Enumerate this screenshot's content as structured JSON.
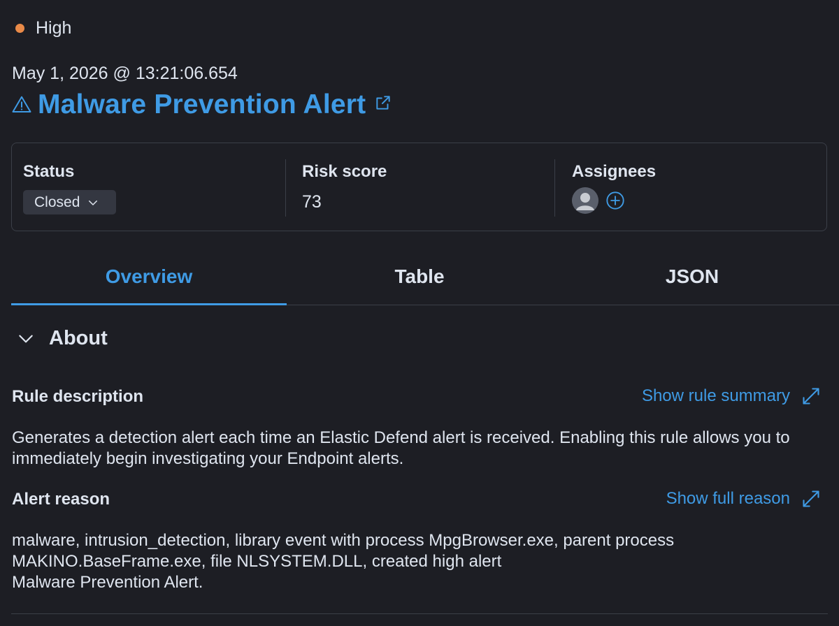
{
  "severity": {
    "label": "High",
    "color": "#e98a48"
  },
  "alert": {
    "timestamp": "May 1, 2026 @ 13:21:06.654",
    "title": "Malware Prevention Alert",
    "title_icon": "warning-icon",
    "link_icon": "external-link-icon"
  },
  "summary": {
    "status": {
      "label": "Status",
      "value": "Closed",
      "icon": "chevron-down-icon"
    },
    "risk": {
      "label": "Risk score",
      "value": "73"
    },
    "assignees": {
      "label": "Assignees",
      "avatar_icon": "user-avatar-icon",
      "add_icon": "plus-circle-icon"
    }
  },
  "tabs": [
    {
      "label": "Overview",
      "active": true
    },
    {
      "label": "Table",
      "active": false
    },
    {
      "label": "JSON",
      "active": false
    }
  ],
  "about": {
    "title": "About",
    "icon": "chevron-down-icon",
    "rule_description": {
      "label": "Rule description",
      "link": "Show rule summary",
      "link_icon": "expand-icon",
      "text": "Generates a detection alert each time an Elastic Defend alert is received. Enabling this rule allows you to immediately begin investigating your Endpoint alerts."
    },
    "alert_reason": {
      "label": "Alert reason",
      "link": "Show full reason",
      "link_icon": "expand-icon",
      "line1": "malware, intrusion_detection, library event with process MpgBrowser.exe, parent process",
      "line2": "MAKINO.BaseFrame.exe, file NLSYSTEM.DLL, created high alert",
      "line3": "Malware Prevention Alert."
    }
  },
  "colors": {
    "background": "#1d1e24",
    "accent": "#3f9be5",
    "text": "#dfe5ef",
    "border": "#3b3f48"
  }
}
